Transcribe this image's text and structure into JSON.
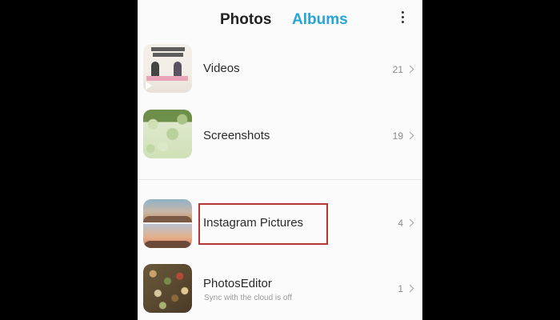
{
  "tabs": {
    "photos": "Photos",
    "albums": "Albums"
  },
  "menu_icon": "more-vertical-icon",
  "accent_color": "#27a4d8",
  "highlight_color": "#b43737",
  "albums": [
    {
      "name": "Videos",
      "count": "21",
      "subtitle": ""
    },
    {
      "name": "Screenshots",
      "count": "19",
      "subtitle": ""
    },
    {
      "name": "Instagram Pictures",
      "count": "4",
      "subtitle": ""
    },
    {
      "name": "PhotosEditor",
      "count": "1",
      "subtitle": "Sync with the cloud is off"
    }
  ]
}
